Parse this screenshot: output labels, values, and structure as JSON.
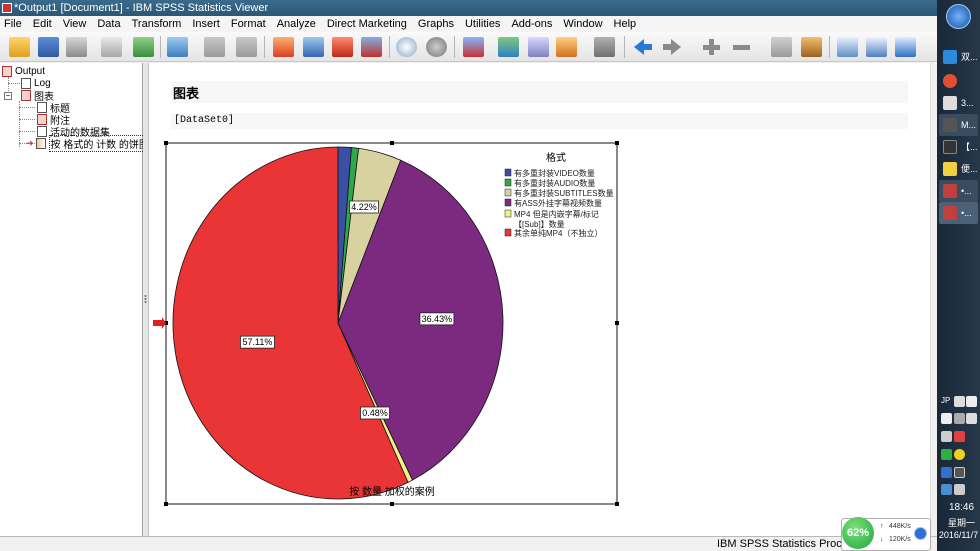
{
  "window": {
    "title": "*Output1 [Document1] - IBM SPSS Statistics Viewer"
  },
  "menubar": {
    "items": [
      "File",
      "Edit",
      "View",
      "Data",
      "Transform",
      "Insert",
      "Format",
      "Analyze",
      "Direct Marketing",
      "Graphs",
      "Utilities",
      "Add-ons",
      "Window",
      "Help"
    ]
  },
  "toolbar": {
    "icons": [
      "open-icon",
      "save-icon",
      "print-icon",
      "print-preview-icon",
      "export-icon",
      "recall-dialog-icon",
      "undo-icon",
      "redo-icon",
      "goto-data-icon",
      "goto-case-icon",
      "goto-variable-icon",
      "variables-icon",
      "designate-window-icon",
      "select-last-output-icon",
      "show-all-icon",
      "hide-icon",
      "expand-icon",
      "collapse-icon",
      "promote-icon",
      "demote-icon",
      "insert-heading-icon",
      "insert-title-icon",
      "insert-text-icon",
      "insert-new-page-icon",
      "scripting-icon",
      "custom-dialog-icon"
    ]
  },
  "outline": {
    "root": "Output",
    "items": [
      {
        "label": "Log",
        "level": 1
      },
      {
        "label": "图表",
        "level": 1
      },
      {
        "label": "标题",
        "level": 2
      },
      {
        "label": "附注",
        "level": 2
      },
      {
        "label": "活动的数据集",
        "level": 2
      },
      {
        "label": "按 格式的 计数 的饼图",
        "level": 2,
        "selected": true
      }
    ]
  },
  "content": {
    "heading": "图表",
    "dataset": "[DataSet0]"
  },
  "chart_data": {
    "type": "pie",
    "footer": "按 数量 加权的案例",
    "legend_title": "格式",
    "legend_position": "top-right",
    "series": [
      {
        "name": "有多重封装VIDEO数量",
        "value": 1.3,
        "color": "#3b4fa5"
      },
      {
        "name": "有多重封装AUDIO数量",
        "value": 0.7,
        "color": "#2ea84a"
      },
      {
        "name": "有多重封装SUBTITLES数量",
        "value": 4.22,
        "color": "#d8d2a0"
      },
      {
        "name": "有ASS外挂字幕视频数量",
        "value": 36.43,
        "color": "#7b2a7f"
      },
      {
        "name": "MP4 但是内嵌字幕/标记【[Sub]】数量",
        "value": 0.48,
        "color": "#f2f08a"
      },
      {
        "name": "其余单纯MP4（不独立）",
        "value": 57.11,
        "color": "#ea3536"
      }
    ],
    "labels": [
      "4.22%",
      "36.43%",
      "0.48%",
      "57.11%"
    ]
  },
  "statusbar": {
    "text": "IBM SPSS Statistics Processor is"
  },
  "taskbar": {
    "buttons": [
      "双...",
      "3...",
      "M...",
      "【...",
      "便...",
      "•...",
      "•..."
    ],
    "tray_label": "JP",
    "time": "18:46",
    "day": "星期一",
    "date": "2016/11/7",
    "net_percent": "62%",
    "upload": "448K/s",
    "download": "120K/s"
  }
}
